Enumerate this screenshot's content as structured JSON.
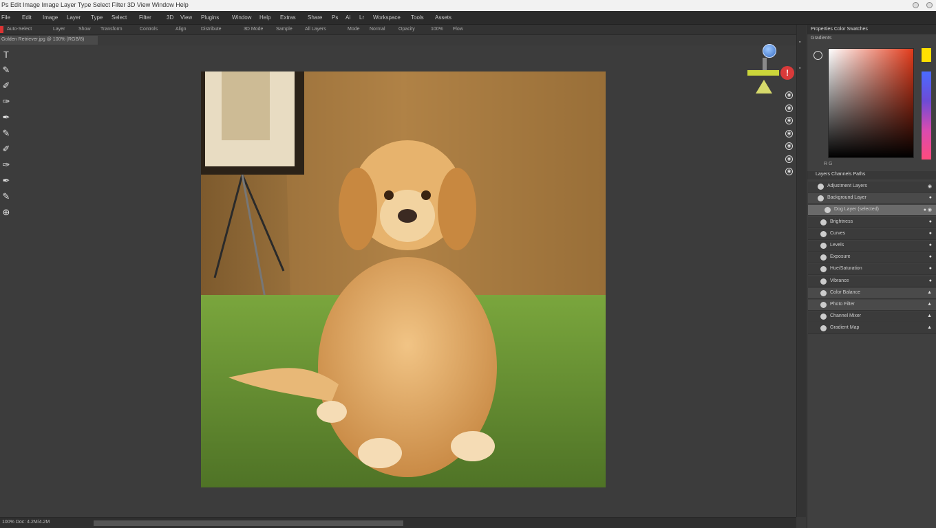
{
  "window": {
    "title": "Ps Edit Image Image Layer Type Select Filter 3D View Window Help"
  },
  "menubar": {
    "items": [
      "File",
      "Edit",
      "Image",
      "Layer",
      "Type",
      "Select",
      "Filter",
      "3D",
      "View",
      "Plugins",
      "Window",
      "Help",
      "Extras",
      "Share",
      "Ps",
      "Ai",
      "Lr",
      "Workspace",
      "Tools",
      "Assets"
    ]
  },
  "optionsbar": {
    "items": [
      "Auto-Select",
      "Layer",
      "Show",
      "Transform",
      "Controls",
      "Align",
      "Distribute",
      "3D Mode",
      "Sample",
      "All Layers",
      "Mode",
      "Normal",
      "Opacity",
      "100%",
      "Flow"
    ]
  },
  "document": {
    "tab_label": "Golden Retriever.jpg @ 100% (RGB/8)"
  },
  "tools": {
    "items": [
      {
        "name": "type-tool",
        "glyph": "T"
      },
      {
        "name": "brush-tool",
        "glyph": "✎"
      },
      {
        "name": "clone-tool",
        "glyph": "✐"
      },
      {
        "name": "eraser-tool",
        "glyph": "✑"
      },
      {
        "name": "gradient-tool",
        "glyph": "✒"
      },
      {
        "name": "dodge-tool",
        "glyph": "✎"
      },
      {
        "name": "pen-tool",
        "glyph": "✐"
      },
      {
        "name": "path-tool",
        "glyph": "✑"
      },
      {
        "name": "shape-tool",
        "glyph": "✒"
      },
      {
        "name": "hand-tool",
        "glyph": "✎"
      },
      {
        "name": "zoom-tool",
        "glyph": "⊕"
      }
    ]
  },
  "panel": {
    "color_title": "Properties Color Swatches",
    "color_subtitle": "Gradients",
    "color_footer": "R G",
    "foreground_color": "#ffe000",
    "layers_title": "Layers Channels Paths"
  },
  "layers": [
    {
      "label": "Adjustment Layers",
      "state": "normal",
      "eye": "◉"
    },
    {
      "label": "Background Layer",
      "state": "alt",
      "eye": "●"
    },
    {
      "label": "Dog Layer (selected)",
      "state": "selected",
      "eye": "● ◉"
    },
    {
      "label": "Brightness",
      "state": "normal",
      "eye": "●"
    },
    {
      "label": "Curves",
      "state": "normal",
      "eye": "●"
    },
    {
      "label": "Levels",
      "state": "normal",
      "eye": "●"
    },
    {
      "label": "Exposure",
      "state": "normal",
      "eye": "●"
    },
    {
      "label": "Hue/Saturation",
      "state": "normal",
      "eye": "●"
    },
    {
      "label": "Vibrance",
      "state": "normal",
      "eye": "●"
    },
    {
      "label": "Color Balance",
      "state": "alt",
      "eye": "▲"
    },
    {
      "label": "Photo Filter",
      "state": "alt",
      "eye": "▲"
    },
    {
      "label": "Channel Mixer",
      "state": "normal",
      "eye": "▲"
    },
    {
      "label": "Gradient Map",
      "state": "normal",
      "eye": "▲"
    }
  ],
  "statusbar": {
    "text": "100% Doc: 4.2M/4.2M"
  },
  "gizmo": {
    "badge": "!"
  },
  "side_icons": [
    "◉",
    "◉",
    "◉",
    "◉",
    "◉",
    "◉",
    "◉"
  ]
}
